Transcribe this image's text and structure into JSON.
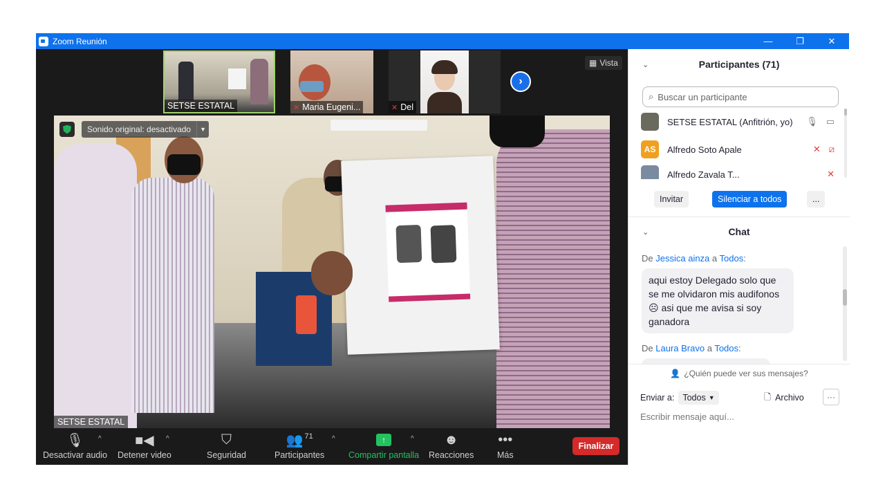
{
  "window": {
    "title": "Zoom Reunión",
    "controls": {
      "minimize": "—",
      "restore": "❐",
      "close": "✕"
    }
  },
  "gallery": {
    "thumbnails": [
      {
        "label": "SETSE ESTATAL",
        "muted": false
      },
      {
        "label": "Maria Eugeni...",
        "muted": true
      },
      {
        "label": "Del",
        "muted": true
      }
    ],
    "next_icon": "›",
    "vista_label": "Vista"
  },
  "main_video": {
    "audio_status": "Sonido original: desactivado",
    "speaker_label": "SETSE ESTATAL"
  },
  "toolbar": {
    "mute_audio": "Desactivar audio",
    "stop_video": "Detener video",
    "security": "Seguridad",
    "participants": "Participantes",
    "participants_count": "71",
    "share_screen": "Compartir pantalla",
    "reactions": "Reacciones",
    "more": "Más",
    "end": "Finalizar"
  },
  "participants_panel": {
    "title": "Participantes (71)",
    "search_placeholder": "Buscar un participante",
    "items": [
      {
        "name": "SETSE ESTATAL (Anfitrión, yo)",
        "initials": "",
        "avatar_color": "#6b6a5e",
        "muted": false
      },
      {
        "name": "Alfredo Soto Apale",
        "initials": "AS",
        "avatar_color": "#f0a020",
        "muted": true
      },
      {
        "name": "Alfredo Zavala T...",
        "initials": "",
        "avatar_color": "#7a8aa0",
        "muted": true
      }
    ],
    "invite": "Invitar",
    "mute_all": "Silenciar a todos",
    "more": "..."
  },
  "chat_panel": {
    "title": "Chat",
    "messages": [
      {
        "prefix": "De",
        "sender": "Jessica ainza",
        "connector": "a",
        "recipient": "Todos",
        "text": "aqui estoy Delegado solo que se me olvidaron mis audifonos ☹ asi que me avisa si soy ganadora"
      },
      {
        "prefix": "De",
        "sender": "Laura Bravo",
        "connector": "a",
        "recipient": "Todos",
        "text": ""
      }
    ],
    "who_can_see": "¿Quién puede ver sus mensajes?",
    "send_to_label": "Enviar a:",
    "send_to_value": "Todos",
    "file_label": "Archivo",
    "more": "···",
    "compose_placeholder": "Escribir mensaje aquí..."
  }
}
